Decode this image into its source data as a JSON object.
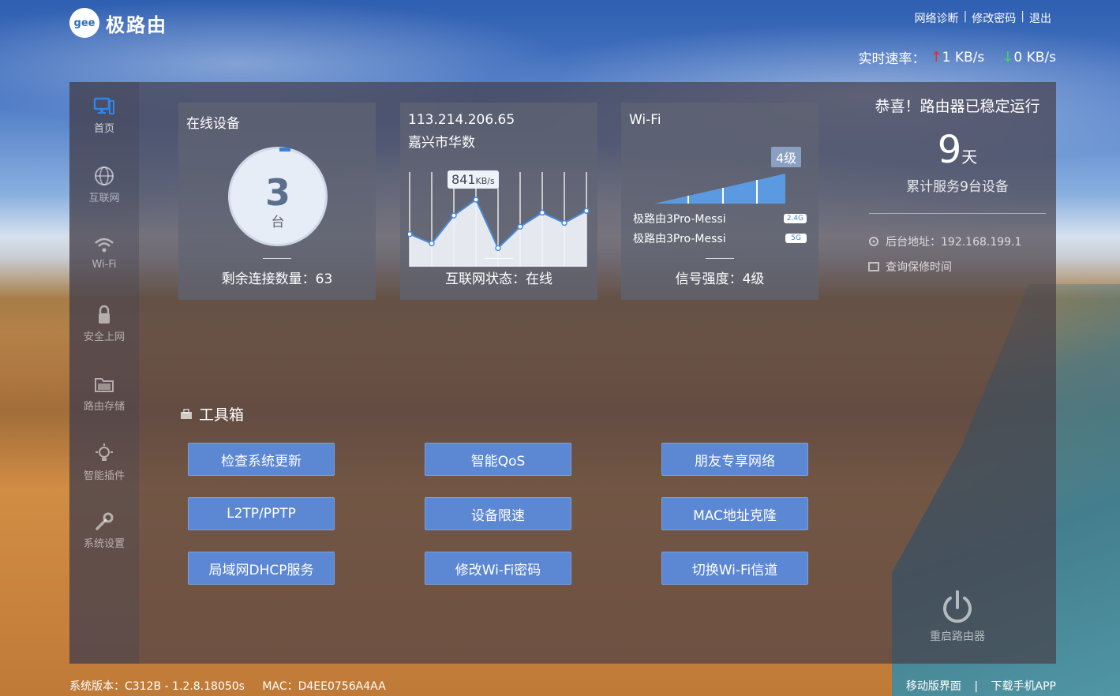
{
  "header": {
    "logo_badge": "gee",
    "brand": "极路由",
    "links": [
      "网络诊断",
      "修改密码",
      "退出"
    ],
    "speed_label": "实时速率：",
    "upload": "1 KB/s",
    "download": "0 KB/s"
  },
  "sidebar": {
    "items": [
      {
        "label": "首页",
        "icon": "monitor-icon",
        "active": true
      },
      {
        "label": "互联网",
        "icon": "globe-icon"
      },
      {
        "label": "Wi-Fi",
        "icon": "wifi-icon"
      },
      {
        "label": "安全上网",
        "icon": "lock-icon"
      },
      {
        "label": "路由存储",
        "icon": "folder-icon"
      },
      {
        "label": "智能插件",
        "icon": "bulb-icon"
      },
      {
        "label": "系统设置",
        "icon": "wrench-icon"
      }
    ]
  },
  "cards": {
    "devices": {
      "title": "在线设备",
      "count": "3",
      "unit": "台",
      "footer": "剩余连接数量：63"
    },
    "internet": {
      "ip": "113.214.206.65",
      "location": "嘉兴市华数",
      "speed_value": "841",
      "speed_unit": "KB/s",
      "footer": "互联网状态：在线",
      "chart_values": [
        0.35,
        0.25,
        0.55,
        0.72,
        0.2,
        0.43,
        0.58,
        0.47,
        0.6
      ]
    },
    "wifi": {
      "title": "Wi-Fi",
      "level_badge": "4级",
      "ssid_24": "极路由3Pro-Messi",
      "tag_24": "2.4G",
      "ssid_5": "极路由3Pro-Messi",
      "tag_5": "5G",
      "footer": "信号强度：4级",
      "signal_level": 4
    }
  },
  "status": {
    "title": "恭喜！路由器已稳定运行",
    "days": "9",
    "days_unit": "天",
    "served": "累计服务9台设备",
    "admin_address": "后台地址：192.168.199.1",
    "warranty": "查询保修时间",
    "reboot": "重启路由器"
  },
  "toolbox": {
    "title": "工具箱",
    "buttons": [
      "检查系统更新",
      "智能QoS",
      "朋友专享网络",
      "L2TP/PPTP",
      "设备限速",
      "MAC地址克隆",
      "局域网DHCP服务",
      "修改Wi-Fi密码",
      "切换Wi-Fi信道"
    ]
  },
  "footer": {
    "version": "系统版本：C312B - 1.2.8.18050s",
    "mac": "MAC：D4EE0756A4AA",
    "mobile": "移动版界面",
    "app": "下载手机APP"
  }
}
